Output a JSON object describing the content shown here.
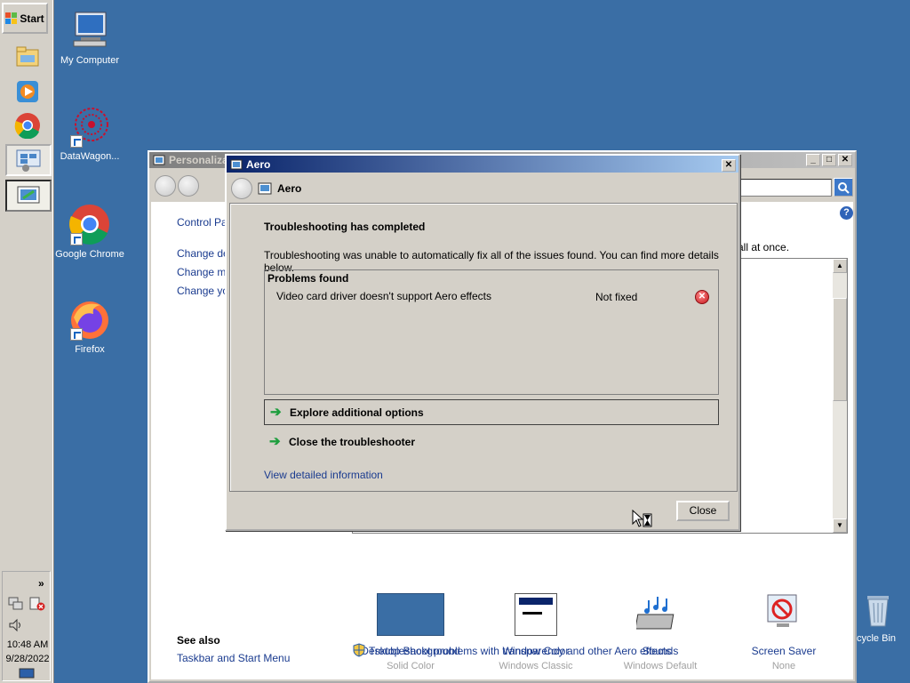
{
  "taskbar": {
    "start_label": "Start",
    "clock_time": "10:48 AM",
    "clock_date": "9/28/2022",
    "tray_expand": "»"
  },
  "desktop": {
    "icons": [
      {
        "label": "My Computer"
      },
      {
        "label": "DataWagon..."
      },
      {
        "label": "Google Chrome"
      },
      {
        "label": "Firefox"
      },
      {
        "label": "cycle Bin"
      }
    ]
  },
  "personalization_window": {
    "title": "Personaliza",
    "breadcrumb": "Control Pan",
    "links": [
      "Change des",
      "Change mo",
      "Change you"
    ],
    "text_fragment": "all at once.",
    "items": [
      {
        "label": "Desktop Background",
        "sub": "Solid Color"
      },
      {
        "label": "Window Color",
        "sub": "Windows Classic"
      },
      {
        "label": "Sounds",
        "sub": "Windows Default"
      },
      {
        "label": "Screen Saver",
        "sub": "None"
      }
    ],
    "see_also_heading": "See also",
    "see_also_link": "Taskbar and Start Menu",
    "troubleshoot_link": "Troubleshoot problems with transparency and other Aero effects",
    "help_glyph": "?"
  },
  "dialog": {
    "title": "Aero",
    "nav_title": "Aero",
    "heading": "Troubleshooting has completed",
    "description": "Troubleshooting was unable to automatically fix all of the issues found. You can find more details below.",
    "problems_header": "Problems found",
    "problems": [
      {
        "name": "Video card driver doesn't support Aero effects",
        "status": "Not fixed"
      }
    ],
    "options": [
      {
        "label": "Explore additional options"
      },
      {
        "label": "Close the troubleshooter"
      }
    ],
    "detail_link": "View detailed information",
    "close_button": "Close"
  },
  "colors": {
    "desktop": "#3a6ea5",
    "active_title": "#0a246a",
    "link": "#1a3b8f",
    "arrow_green": "#1e9e3e",
    "error_red": "#c4161c"
  }
}
